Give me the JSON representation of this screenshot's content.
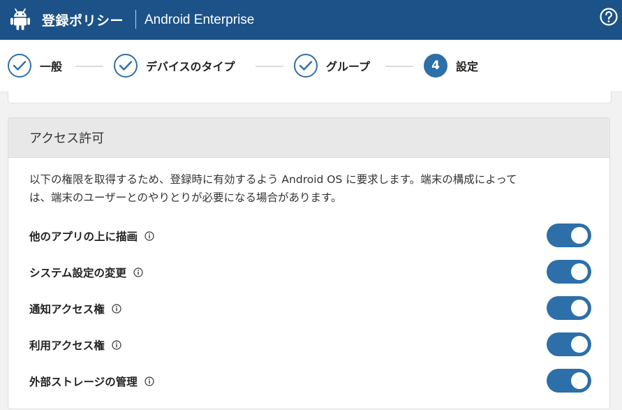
{
  "header": {
    "title": "登録ポリシー",
    "subtitle": "Android Enterprise"
  },
  "icons": {
    "brand": "android-icon",
    "help": "help-icon",
    "step_done": "checkmark-icon",
    "info": "info-icon"
  },
  "colors": {
    "header_bg": "#1c5288",
    "accent": "#2d6fa8"
  },
  "steps": [
    {
      "label": "一般",
      "state": "done"
    },
    {
      "label": "デバイスのタイプ",
      "state": "done"
    },
    {
      "label": "グループ",
      "state": "done"
    },
    {
      "label": "設定",
      "state": "active",
      "number": "4"
    }
  ],
  "section": {
    "title": "アクセス許可",
    "description_line1": "以下の権限を取得するため、登録時に有効するよう Android OS に要求します。端末の構成によって",
    "description_line2": "は、端末のユーザーとのやりとりが必要になる場合があります。"
  },
  "permissions": [
    {
      "label": "他のアプリの上に描画",
      "enabled": true
    },
    {
      "label": "システム設定の変更",
      "enabled": true
    },
    {
      "label": "通知アクセス権",
      "enabled": true
    },
    {
      "label": "利用アクセス権",
      "enabled": true
    },
    {
      "label": "外部ストレージの管理",
      "enabled": true
    }
  ]
}
